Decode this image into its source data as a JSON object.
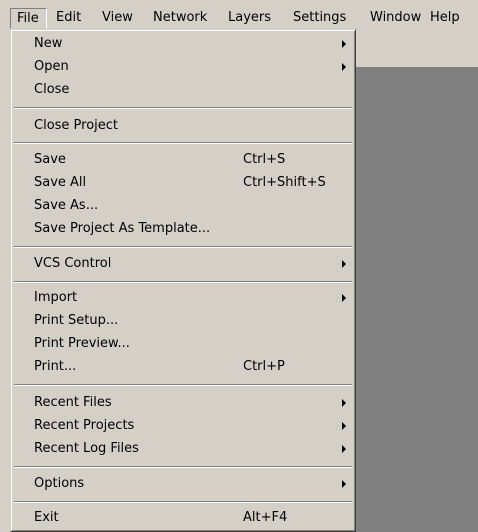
{
  "menubar": {
    "items": [
      {
        "label": "File"
      },
      {
        "label": "Edit"
      },
      {
        "label": "View"
      },
      {
        "label": "Network"
      },
      {
        "label": "Layers"
      },
      {
        "label": "Settings"
      },
      {
        "label": "Window"
      },
      {
        "label": "Help"
      }
    ]
  },
  "file_menu": {
    "items": [
      {
        "label": "New",
        "shortcut": "",
        "submenu": true
      },
      {
        "label": "Open",
        "shortcut": "",
        "submenu": true
      },
      {
        "label": "Close",
        "shortcut": "",
        "submenu": false
      },
      {
        "label": "Close Project",
        "shortcut": "",
        "submenu": false
      },
      {
        "label": "Save",
        "shortcut": "Ctrl+S",
        "submenu": false
      },
      {
        "label": "Save All",
        "shortcut": "Ctrl+Shift+S",
        "submenu": false
      },
      {
        "label": "Save As...",
        "shortcut": "",
        "submenu": false
      },
      {
        "label": "Save Project As Template...",
        "shortcut": "",
        "submenu": false
      },
      {
        "label": "VCS Control",
        "shortcut": "",
        "submenu": true
      },
      {
        "label": "Import",
        "shortcut": "",
        "submenu": true
      },
      {
        "label": "Print Setup...",
        "shortcut": "",
        "submenu": false
      },
      {
        "label": "Print Preview...",
        "shortcut": "",
        "submenu": false
      },
      {
        "label": "Print...",
        "shortcut": "Ctrl+P",
        "submenu": false
      },
      {
        "label": "Recent Files",
        "shortcut": "",
        "submenu": true
      },
      {
        "label": "Recent Projects",
        "shortcut": "",
        "submenu": true
      },
      {
        "label": "Recent Log Files",
        "shortcut": "",
        "submenu": true
      },
      {
        "label": "Options",
        "shortcut": "",
        "submenu": true
      },
      {
        "label": "Exit",
        "shortcut": "Alt+F4",
        "submenu": false
      }
    ]
  }
}
